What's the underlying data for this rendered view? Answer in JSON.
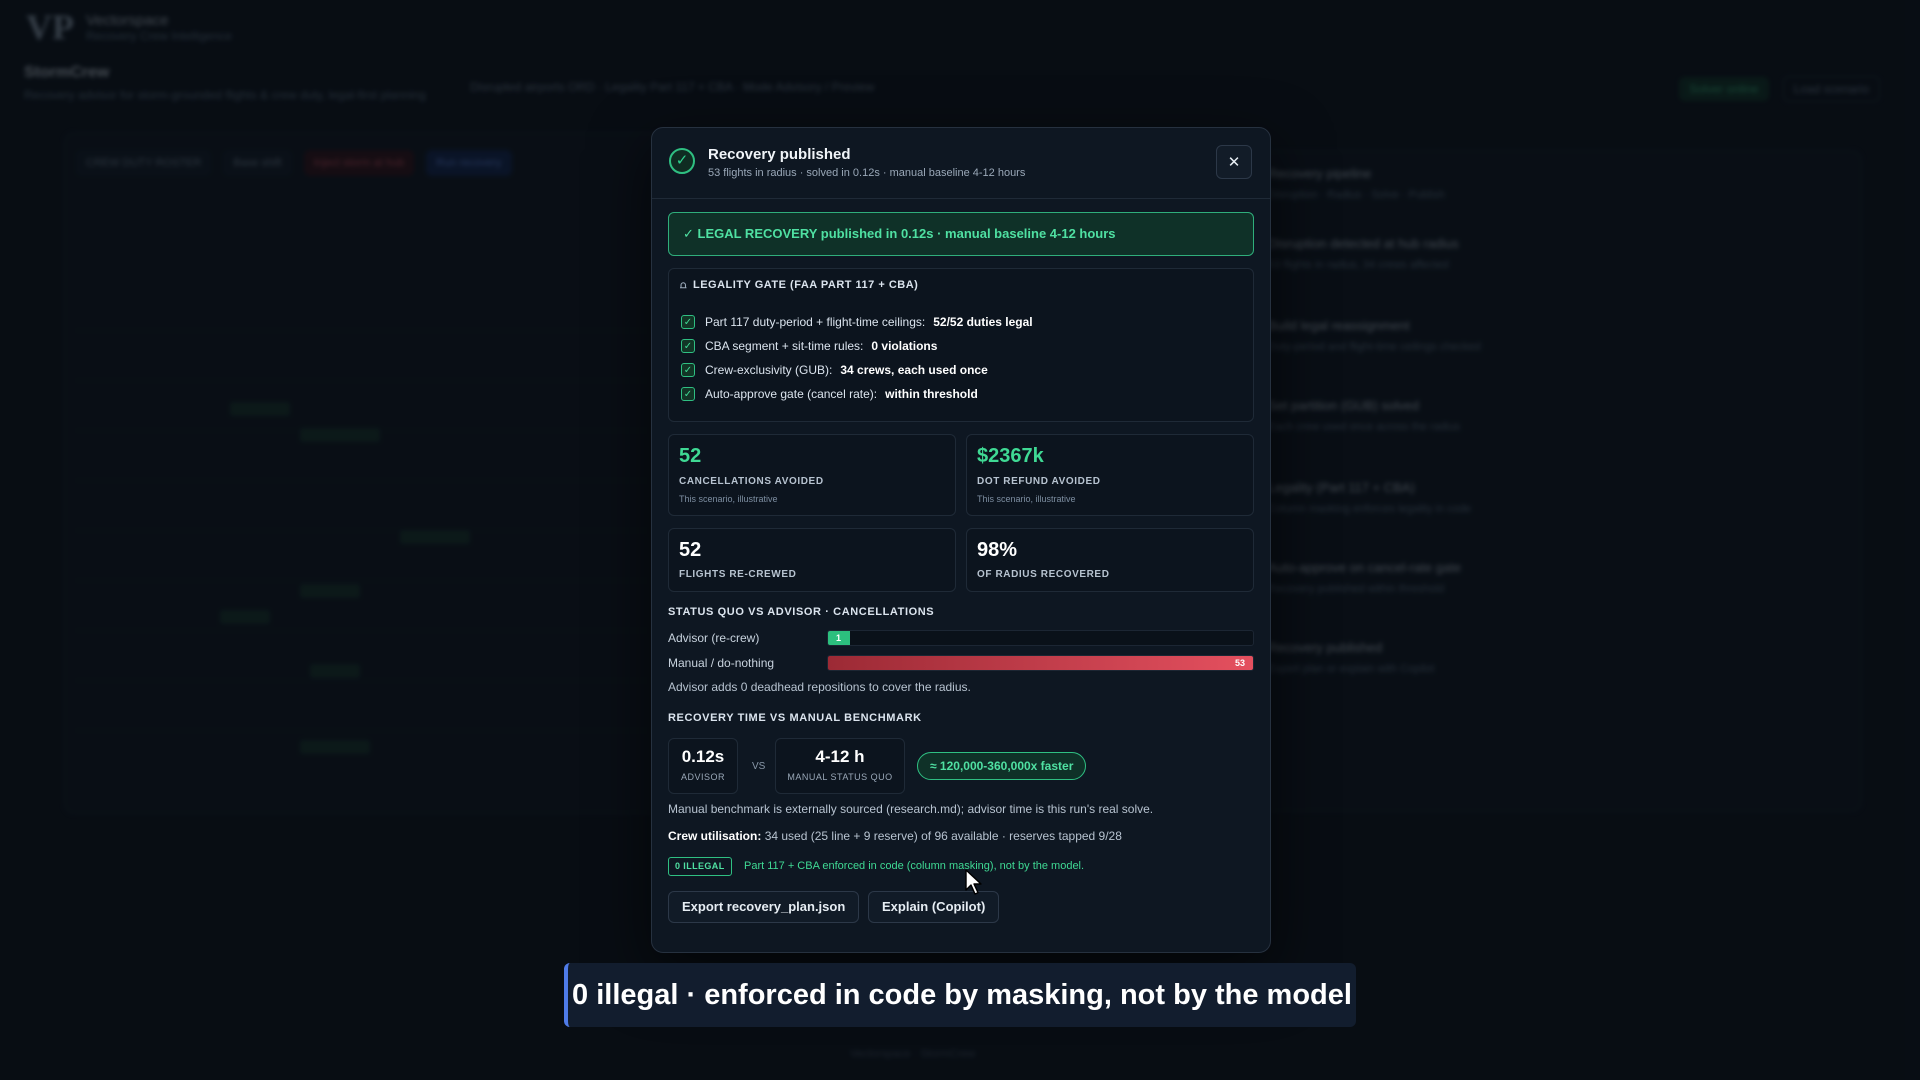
{
  "background": {
    "brand_name": "Vectorspace",
    "brand_sub": "Recovery Crew Intelligence",
    "app_title": "StormCrew",
    "app_sub": "Recovery advisor for storm-grounded flights & crew duty, legal-first planning",
    "header_meta": "Disrupted airports ORD · Legality Part 117 + CBA · Mode Advisory / Preview",
    "header_right_status": "Solver online",
    "header_right_action": "Load scenario",
    "toolbar": [
      "CREW DUTY ROSTER",
      "Base shift",
      "Inject storm at hub",
      "Run recovery"
    ],
    "right_items": [
      {
        "title": "Recovery pipeline",
        "desc": "Disruption · Radius · Solve · Publish"
      },
      {
        "title": "Disruption detected at hub radius",
        "desc": "53 flights in radius, 34 crews affected"
      },
      {
        "title": "Build legal reassignment",
        "desc": "Duty-period and flight-time ceilings checked"
      },
      {
        "title": "Set partition (GUB) solved",
        "desc": "Each crew used once across the radius"
      },
      {
        "title": "Legality (Part 117 + CBA)",
        "desc": "Column masking enforces legality in code"
      },
      {
        "title": "Auto-approve on cancel-rate gate",
        "desc": "Recovery published within threshold"
      },
      {
        "title": "Recovery published",
        "desc": "Export plan or explain with Copilot"
      }
    ],
    "footer_tag": "Vectorspace · StormCrew"
  },
  "modal": {
    "title": "Recovery published",
    "subtitle": "53 flights in radius · solved in 0.12s · manual baseline 4-12 hours",
    "close_icon": "✕",
    "banner": "✓ LEGAL RECOVERY published in 0.12s  ·  manual baseline 4-12 hours",
    "gate": {
      "title": "LEGALITY GATE (FAA PART 117 + CBA)",
      "rows": [
        {
          "label": "Part 117 duty-period + flight-time ceilings:",
          "value": "52/52 duties legal"
        },
        {
          "label": "CBA segment + sit-time rules:",
          "value": "0 violations"
        },
        {
          "label": "Crew-exclusivity (GUB):",
          "value": "34 crews, each used once"
        },
        {
          "label": "Auto-approve gate (cancel rate):",
          "value": "within threshold"
        }
      ]
    },
    "stats": [
      {
        "value": "52",
        "label": "CANCELLATIONS AVOIDED",
        "note": "This scenario, illustrative"
      },
      {
        "value": "$2367k",
        "label": "DOT REFUND AVOIDED",
        "note": "This scenario, illustrative"
      },
      {
        "value": "52",
        "label": "FLIGHTS RE-CREWED"
      },
      {
        "value": "98%",
        "label": "OF RADIUS RECOVERED"
      }
    ],
    "comparison": {
      "title": "STATUS QUO VS ADVISOR · CANCELLATIONS",
      "max": 53,
      "bars": [
        {
          "label": "Advisor (re-crew)",
          "value": 1,
          "value_text": "1",
          "color": "#2cbf7e"
        },
        {
          "label": "Manual / do-nothing",
          "value": 53,
          "value_text": "53",
          "color": "#e5505f"
        }
      ],
      "note": "Advisor adds 0 deadhead repositions to cover the radius."
    },
    "benchmark": {
      "title": "RECOVERY TIME VS MANUAL BENCHMARK",
      "advisor_value": "0.12s",
      "advisor_label": "ADVISOR",
      "vs": "VS",
      "manual_value": "4-12 h",
      "manual_label": "MANUAL STATUS QUO",
      "faster": "≈ 120,000-360,000x faster",
      "note": "Manual benchmark is externally sourced (research.md); advisor time is this run's real solve."
    },
    "utilisation": {
      "label": "Crew utilisation:",
      "text": "34 used (25 line + 9 reserve) of 96 available · reserves tapped 9/28"
    },
    "illegal": {
      "badge": "0 ILLEGAL",
      "text": "Part 117 + CBA enforced in code (column masking), not by the model."
    },
    "buttons": {
      "export": "Export recovery_plan.json",
      "explain": "Explain (Copilot)"
    }
  },
  "caption": "0 illegal · enforced in code by masking, not by the model"
}
